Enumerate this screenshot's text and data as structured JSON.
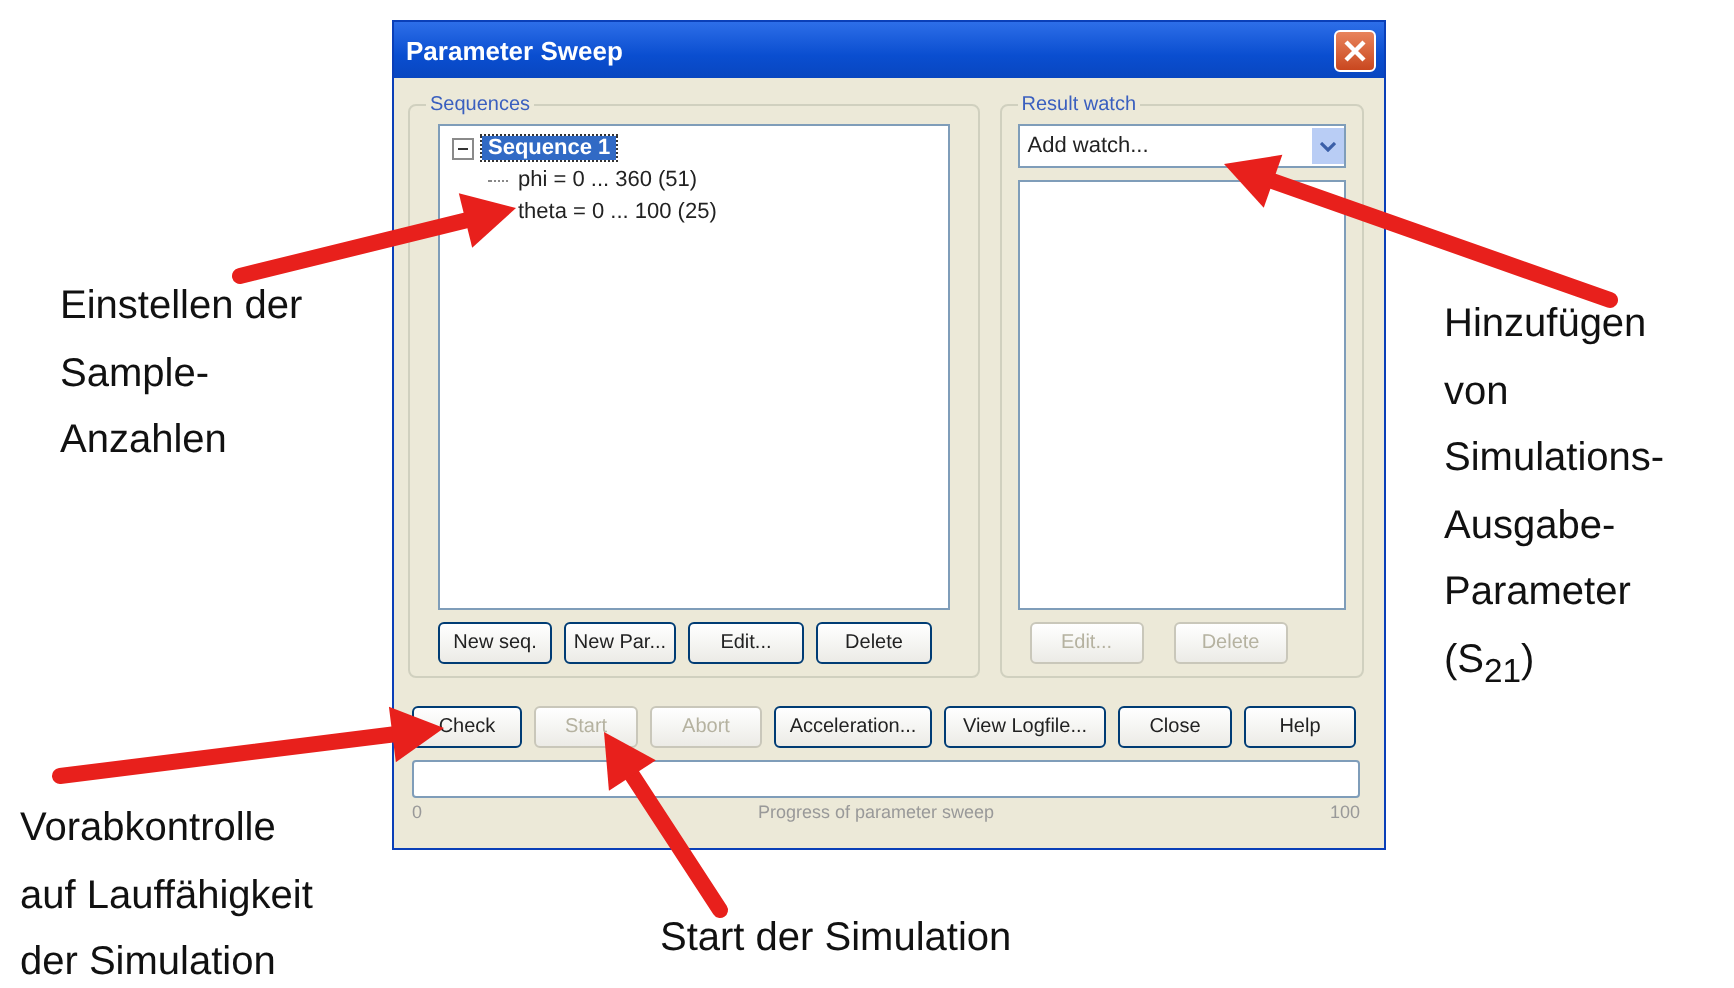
{
  "window": {
    "title": "Parameter Sweep"
  },
  "sequences": {
    "label": "Sequences",
    "tree": [
      {
        "label": "Sequence 1",
        "selected": true,
        "expanded": true,
        "children": [
          {
            "label": "phi = 0 ... 360 (51)",
            "selected": false
          },
          {
            "label": "theta = 0 ... 100 (25)",
            "selected": false
          }
        ]
      }
    ],
    "buttons": [
      {
        "label": "New seq.",
        "disabled": false
      },
      {
        "label": "New Par...",
        "disabled": false
      },
      {
        "label": "Edit...",
        "disabled": false
      },
      {
        "label": "Delete",
        "disabled": false
      }
    ]
  },
  "result_watch": {
    "label": "Result watch",
    "dropdown": "Add watch...",
    "buttons": [
      {
        "label": "Edit...",
        "disabled": true
      },
      {
        "label": "Delete",
        "disabled": true
      }
    ]
  },
  "actions": [
    {
      "label": "Check",
      "disabled": false
    },
    {
      "label": "Start",
      "disabled": true
    },
    {
      "label": "Abort",
      "disabled": true
    },
    {
      "label": "Acceleration...",
      "disabled": false
    },
    {
      "label": "View Logfile...",
      "disabled": false
    },
    {
      "label": "Close",
      "disabled": false
    },
    {
      "label": "Help",
      "disabled": false
    }
  ],
  "progress": {
    "level": 0,
    "min": "0",
    "caption": "Progress of parameter sweep",
    "max": "100"
  },
  "annotations": [
    {
      "text": "Einstellen der\nSample-\nAnzahlen"
    },
    {
      "text": "Hinzufügen\nvon\nSimulations-\nAusgabe-\nParameter\n(S$_{21}$)"
    },
    {
      "text": "Vorabkontrolle\nauf Lauffähigkeit\nder Simulation"
    },
    {
      "text": "Start der Simulation"
    }
  ]
}
